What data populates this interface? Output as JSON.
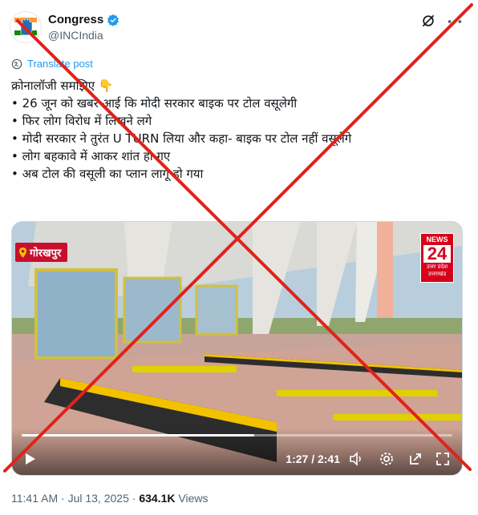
{
  "author": {
    "name": "Congress",
    "handle": "@INCIndia"
  },
  "translate_label": "Translate post",
  "body_lines": [
    "क्रोनालॉजी समझिए 👇",
    "",
    "• 26 जून को खबर आई कि मोदी सरकार बाइक पर टोल वसूलेगी",
    "• फिर लोग विरोध में लिखने लगे",
    "• मोदी सरकार ने तुरंत U TURN लिया और कहा- बाइक पर टोल नहीं वसूलेंगे",
    "• लोग बहकावे में आकर शांत हो गए",
    "• अब टोल की वसूली का प्लान लागू हो गया"
  ],
  "video": {
    "location_tag": "गोरखपुर",
    "channel_logo": {
      "line1": "NEWS",
      "line2": "24",
      "line3a": "उत्तर प्रदेश",
      "line3b": "उत्तराखंड"
    },
    "time_display": "1:27 / 2:41",
    "progress_fraction": 0.54
  },
  "meta": {
    "time": "11:41 AM",
    "date": "Jul 13, 2025",
    "views_count": "634.1K",
    "views_label": "Views"
  },
  "colors": {
    "accent": "#1d9bf0",
    "strike": "#e0221b",
    "tag_red": "#c8102e"
  },
  "icons": [
    "congress-hand-icon",
    "verified-badge-icon",
    "grok-icon",
    "more-icon",
    "translate-icon",
    "location-pin-icon",
    "play-icon",
    "volume-icon",
    "settings-icon",
    "popout-icon",
    "fullscreen-icon"
  ]
}
